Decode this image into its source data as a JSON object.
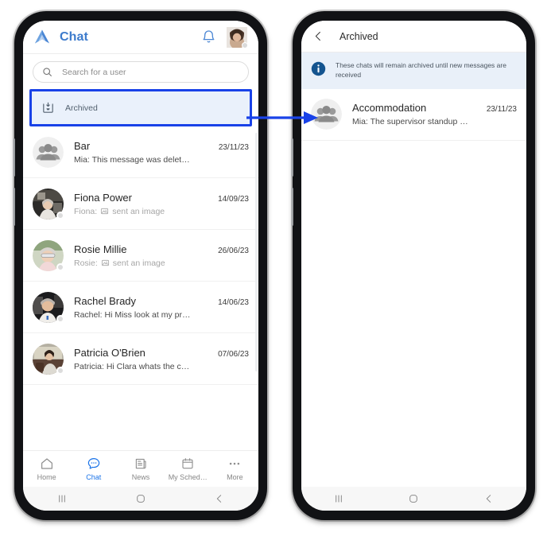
{
  "left_phone": {
    "appbar": {
      "logo_icon": "app-logo-icon",
      "title": "Chat",
      "bell_icon": "bell-icon",
      "avatar_icon": "user-avatar",
      "status_dot": "offline-status-dot"
    },
    "search": {
      "icon": "search-icon",
      "placeholder": "Search for a user",
      "value": ""
    },
    "archived_entry": {
      "icon": "archive-box-icon",
      "label": "Archived",
      "highlight_color": "#1942e8",
      "background_color": "#eaf1fb"
    },
    "chats": [
      {
        "name": "Bar",
        "date": "23/11/23",
        "preview_prefix": "Mia: This message was delet…",
        "preview_muted": false,
        "has_image_glyph": false,
        "avatar_type": "group-avatar",
        "has_status_dot": false
      },
      {
        "name": "Fiona Power",
        "date": "14/09/23",
        "preview_prefix": "Fiona:",
        "preview_suffix": "sent an image",
        "preview_muted": true,
        "has_image_glyph": true,
        "avatar_type": "photo-avatar",
        "has_status_dot": true
      },
      {
        "name": "Rosie Millie",
        "date": "26/06/23",
        "preview_prefix": "Rosie:",
        "preview_suffix": "sent an image",
        "preview_muted": true,
        "has_image_glyph": true,
        "avatar_type": "photo-avatar",
        "has_status_dot": true
      },
      {
        "name": "Rachel Brady",
        "date": "14/06/23",
        "preview_prefix": "Rachel: Hi Miss look at my pr…",
        "preview_muted": false,
        "has_image_glyph": false,
        "avatar_type": "photo-avatar",
        "has_status_dot": true
      },
      {
        "name": "Patricia O'Brien",
        "date": "07/06/23",
        "preview_prefix": "Patricia: Hi Clara whats the c…",
        "preview_muted": false,
        "has_image_glyph": false,
        "avatar_type": "photo-avatar",
        "has_status_dot": true
      }
    ],
    "tabbar": {
      "active_color": "#1a73e8",
      "items": [
        {
          "label": "Home",
          "icon": "home-icon",
          "active": false
        },
        {
          "label": "Chat",
          "icon": "chat-icon",
          "active": true
        },
        {
          "label": "News",
          "icon": "news-icon",
          "active": false
        },
        {
          "label": "My Sched…",
          "icon": "calendar-icon",
          "active": false
        },
        {
          "label": "More",
          "icon": "more-dots-icon",
          "active": false
        }
      ]
    },
    "sysnav": {
      "recents_icon": "recents-icon",
      "home_icon": "home-circle-icon",
      "back_icon": "back-chevron-icon"
    }
  },
  "right_phone": {
    "appbar": {
      "back_icon": "back-chevron-icon",
      "title": "Archived"
    },
    "info_banner": {
      "icon": "info-circle-icon",
      "icon_color": "#14548f",
      "background_color": "#e9f0f9",
      "text": "These chats will remain archived until new messages are received"
    },
    "chats": [
      {
        "name": "Accommodation",
        "date": "23/11/23",
        "preview_prefix": "Mia: The supervisor standup …",
        "preview_muted": false,
        "has_image_glyph": false,
        "avatar_type": "group-avatar",
        "has_status_dot": false
      }
    ],
    "sysnav": {
      "recents_icon": "recents-icon",
      "home_icon": "home-circle-icon",
      "back_icon": "back-chevron-icon"
    }
  },
  "annotation": {
    "arrow_icon": "flow-arrow-icon",
    "arrow_color": "#1942e8"
  }
}
